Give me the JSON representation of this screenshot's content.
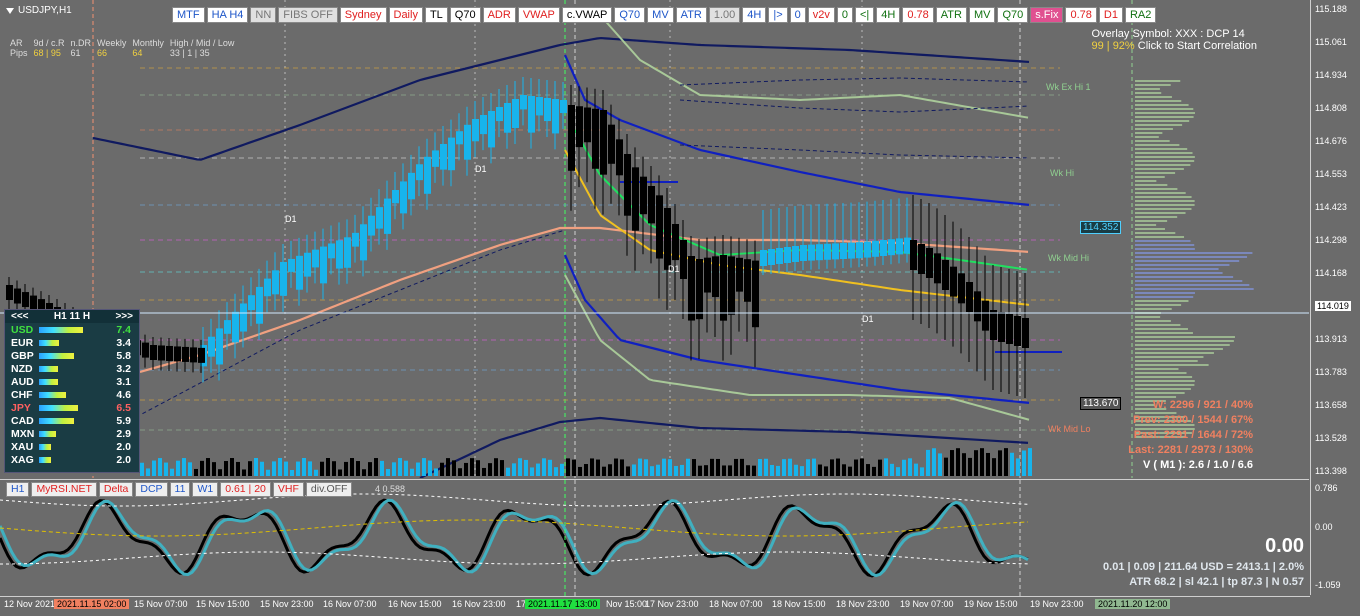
{
  "symbol": {
    "title": "USDJPY,H1"
  },
  "toolbar": [
    {
      "label": "MTF",
      "color": "#1e56c8",
      "bg": "#ffffff"
    },
    {
      "label": "HA H4",
      "color": "#1e56c8",
      "bg": "#ffffff"
    },
    {
      "label": "NN",
      "color": "#777777",
      "bg": "#e0e0e0"
    },
    {
      "label": "FIBS OFF",
      "color": "#777777",
      "bg": "#e0e0e0"
    },
    {
      "label": "Sydney",
      "color": "#e02020",
      "bg": "#ffffff"
    },
    {
      "label": "Daily",
      "color": "#e02020",
      "bg": "#ffffff"
    },
    {
      "label": "TL",
      "color": "#000000",
      "bg": "#ffffff"
    },
    {
      "label": "Q70",
      "color": "#000000",
      "bg": "#ffffff"
    },
    {
      "label": "ADR",
      "color": "#e02020",
      "bg": "#ffffff"
    },
    {
      "label": "VWAP",
      "color": "#e02020",
      "bg": "#ffffff"
    },
    {
      "label": "c.VWAP",
      "color": "#000000",
      "bg": "#ffffff"
    },
    {
      "label": "Q70",
      "color": "#1e56c8",
      "bg": "#ffffff"
    },
    {
      "label": "MV",
      "color": "#1e56c8",
      "bg": "#ffffff"
    },
    {
      "label": "ATR",
      "color": "#1e56c8",
      "bg": "#ffffff"
    },
    {
      "label": "1.00",
      "color": "#777777",
      "bg": "#e0e0e0"
    },
    {
      "label": "4H",
      "color": "#1e56c8",
      "bg": "#ffffff"
    },
    {
      "label": "|>",
      "color": "#1e56c8",
      "bg": "#ffffff"
    },
    {
      "label": "0",
      "color": "#1e56c8",
      "bg": "#ffffff"
    },
    {
      "label": "v2v",
      "color": "#e02020",
      "bg": "#ffffff"
    },
    {
      "label": "0",
      "color": "#107010",
      "bg": "#ffffff"
    },
    {
      "label": "<|",
      "color": "#107010",
      "bg": "#ffffff"
    },
    {
      "label": "4H",
      "color": "#107010",
      "bg": "#ffffff"
    },
    {
      "label": "0.78",
      "color": "#e02020",
      "bg": "#ffffff"
    },
    {
      "label": "ATR",
      "color": "#107010",
      "bg": "#ffffff"
    },
    {
      "label": "MV",
      "color": "#107010",
      "bg": "#ffffff"
    },
    {
      "label": "Q70",
      "color": "#107010",
      "bg": "#ffffff"
    },
    {
      "label": "s.Fix",
      "color": "#ffffff",
      "bg": "#e05090"
    },
    {
      "label": "0.78",
      "color": "#e02020",
      "bg": "#ffffff"
    },
    {
      "label": "D1",
      "color": "#e02020",
      "bg": "#ffffff"
    },
    {
      "label": "RA2",
      "color": "#107010",
      "bg": "#ffffff"
    }
  ],
  "stats_header": {
    "rows": [
      [
        "AR",
        "9d / c.R",
        "n.DR",
        "Weekly",
        "Monthly",
        "High / Mid / Low"
      ],
      [
        "Pips",
        "68 | 95",
        "61",
        "66",
        "64",
        "33  |  1  |  35"
      ]
    ]
  },
  "overlay": {
    "line1": "Overlay Symbol: XXX : DCP 14",
    "line2_yellow": "99 | 92%",
    "line2_rest": "Click to Start Correlation"
  },
  "strength_panel": {
    "header_left": "<<<",
    "header_mid": "H1  11  H",
    "header_right": ">>>",
    "rows": [
      {
        "cur": "USD",
        "val": "7.4",
        "color": "#40e040",
        "bar": 0.92
      },
      {
        "cur": "EUR",
        "val": "3.4",
        "color": "#ffffff",
        "bar": 0.42
      },
      {
        "cur": "GBP",
        "val": "5.8",
        "color": "#ffffff",
        "bar": 0.72
      },
      {
        "cur": "NZD",
        "val": "3.2",
        "color": "#ffffff",
        "bar": 0.4
      },
      {
        "cur": "AUD",
        "val": "3.1",
        "color": "#ffffff",
        "bar": 0.39
      },
      {
        "cur": "CHF",
        "val": "4.6",
        "color": "#ffffff",
        "bar": 0.57
      },
      {
        "cur": "JPY",
        "val": "6.5",
        "color": "#ff6060",
        "bar": 0.81
      },
      {
        "cur": "CAD",
        "val": "5.9",
        "color": "#ffffff",
        "bar": 0.73
      },
      {
        "cur": "MXN",
        "val": "2.9",
        "color": "#ffffff",
        "bar": 0.36
      },
      {
        "cur": "XAU",
        "val": "2.0",
        "color": "#ffffff",
        "bar": 0.25
      },
      {
        "cur": "XAG",
        "val": "2.0",
        "color": "#ffffff",
        "bar": 0.25
      }
    ]
  },
  "right_stats": [
    {
      "text": "W: 2296 / 921 / 40%",
      "color": "#f08060"
    },
    {
      "text": "Prev: 2300 / 1544 / 67%",
      "color": "#f08060"
    },
    {
      "text": "Past: 2291 / 1644 / 72%",
      "color": "#f08060"
    },
    {
      "text": "Last: 2281 / 2973 / 130%",
      "color": "#f08060"
    },
    {
      "text": "V ( M1 ): 2.6 / 1.0 / 6.6",
      "color": "#ffffff"
    }
  ],
  "chart_labels": {
    "wk_ex_hi": "Wk Ex Hi 1",
    "wk_hi": "Wk Hi",
    "wk_mid_hi": "Wk Mid Hi",
    "wk_mid_lo": "Wk Mid Lo",
    "d1": "D1",
    "tag_upper": "114.352",
    "tag_lower": "113.670",
    "current_price": "114.019"
  },
  "price_axis": [
    "115.188",
    "115.061",
    "114.934",
    "114.808",
    "114.676",
    "114.553",
    "114.423",
    "114.298",
    "114.168",
    "114.019",
    "113.913",
    "113.783",
    "113.658",
    "113.528",
    "113.398"
  ],
  "sub_axis": [
    "0.786",
    "0.00",
    "-1.059"
  ],
  "sub_toolbar": [
    {
      "label": "H1",
      "color": "#1e56c8"
    },
    {
      "label": "MyRSI.NET",
      "color": "#e02020"
    },
    {
      "label": "Delta",
      "color": "#e02020"
    },
    {
      "label": "DCP",
      "color": "#1e56c8"
    },
    {
      "label": "11",
      "color": "#1e56c8"
    },
    {
      "label": "W1",
      "color": "#1e56c8"
    },
    {
      "label": "0.61 | 20",
      "color": "#e02020"
    },
    {
      "label": "VHF",
      "color": "#e02020"
    },
    {
      "label": "div.OFF",
      "color": "#555555"
    }
  ],
  "sub_note": "4 0.588",
  "big_value": "0.00",
  "sub_stats": [
    "0.01  |  0.09  |  211.64 USD = 2413.1  |  2.0%",
    "ATR 68.2  |  sl 42.1  |  tp 87.3  |  N 0.57"
  ],
  "time_axis": [
    {
      "text": "12 Nov 2021",
      "hl": ""
    },
    {
      "text": "2021.11.15 02:00",
      "hl": "#f08060"
    },
    {
      "text": "15 Nov 07:00",
      "hl": ""
    },
    {
      "text": "15 Nov 15:00",
      "hl": ""
    },
    {
      "text": "15 Nov 23:00",
      "hl": ""
    },
    {
      "text": "16 Nov 07:00",
      "hl": ""
    },
    {
      "text": "16 Nov 15:00",
      "hl": ""
    },
    {
      "text": "16 Nov 23:00",
      "hl": ""
    },
    {
      "text": "17",
      "hl": ""
    },
    {
      "text": "2021.11.17 13:00",
      "hl": "#20e040"
    },
    {
      "text": "Nov 15:00",
      "hl": ""
    },
    {
      "text": "17 Nov 23:00",
      "hl": ""
    },
    {
      "text": "18 Nov 07:00",
      "hl": ""
    },
    {
      "text": "18 Nov 15:00",
      "hl": ""
    },
    {
      "text": "18 Nov 23:00",
      "hl": ""
    },
    {
      "text": "19 Nov 07:00",
      "hl": ""
    },
    {
      "text": "19 Nov 15:00",
      "hl": ""
    },
    {
      "text": "19 Nov 23:00",
      "hl": ""
    },
    {
      "text": "2021.11.20 12:00",
      "hl": "#90b890"
    }
  ]
}
